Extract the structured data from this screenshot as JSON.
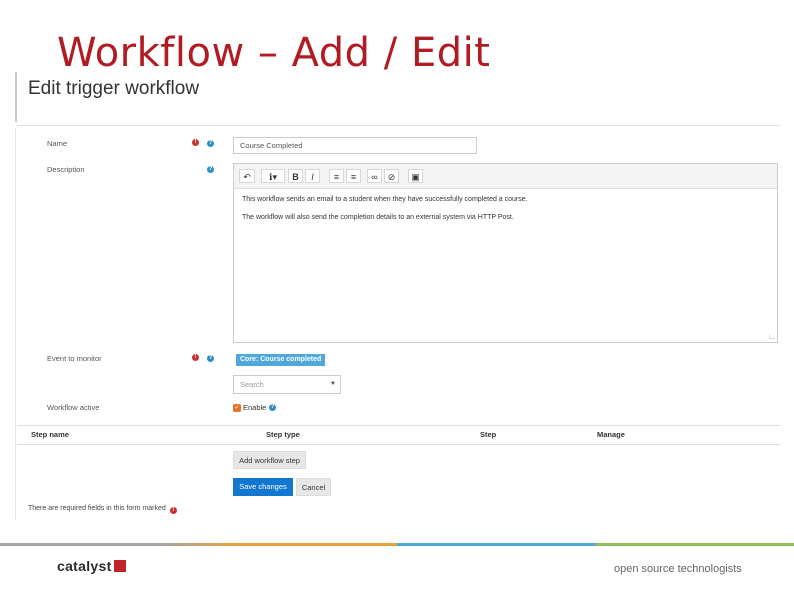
{
  "slide": {
    "title": "Workflow – Add / Edit"
  },
  "form": {
    "heading": "Edit trigger workflow",
    "name_label": "Name",
    "name_value": "Course Completed",
    "description_label": "Description",
    "description_lines": [
      "This workflow sends an email to a student when they have successfully completed a course.",
      "The workflow will also send the completion details to an external system via HTTP Post."
    ],
    "event_label": "Event to monitor",
    "event_badge": "Core: Course completed",
    "search_placeholder": "Search",
    "active_label": "Workflow active",
    "enable_label": "Enable",
    "required_mark": "!",
    "help_mark": "?"
  },
  "toolbar": {
    "icons": [
      "undo-icon",
      "info-icon",
      "bold-icon",
      "italic-icon",
      "bullet-list-icon",
      "numbered-list-icon",
      "link-icon",
      "unlink-icon",
      "image-icon"
    ],
    "bold": "B",
    "italic": "I"
  },
  "table": {
    "headers": [
      "Step name",
      "Step type",
      "Step",
      "Manage"
    ]
  },
  "buttons": {
    "add_step": "Add workflow step",
    "save": "Save changes",
    "cancel": "Cancel"
  },
  "footnote": "There are required fields in this form marked",
  "footer": {
    "logo": "catalyst",
    "tagline": "open source technologists"
  },
  "colors": {
    "title": "#b01c22",
    "primary": "#1177d1",
    "badge": "#4ea8de",
    "required": "#c9302c",
    "help": "#2d8fc4"
  }
}
